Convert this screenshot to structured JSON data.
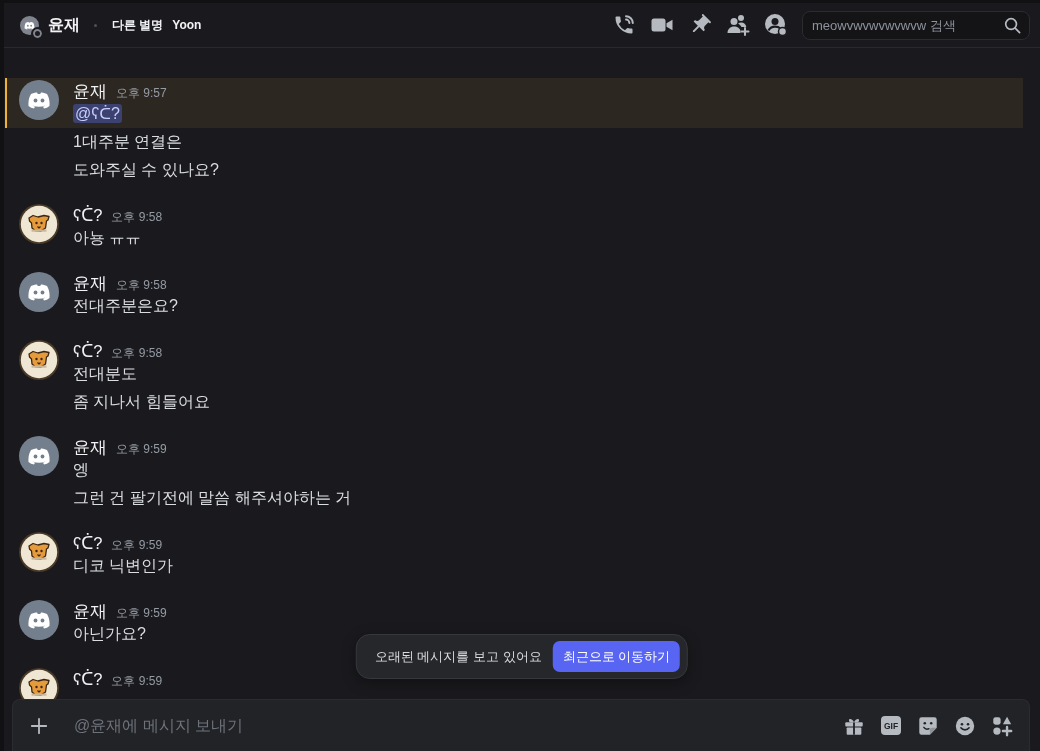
{
  "header": {
    "title": "윤재",
    "online": false,
    "alias_label": "다른 별명",
    "alias": "Yoon",
    "search": {
      "placeholder": "meowvwvwvwvwvw 검색"
    }
  },
  "messages": [
    {
      "author": "윤재",
      "avatar": {
        "kind": "default"
      },
      "time": "오후 9:57",
      "lines": [
        {
          "text": "@ʕᑖ?",
          "kind": "mention",
          "highlighted": true
        },
        {
          "text": "1대주분 연결은",
          "kind": "text",
          "highlighted": false
        },
        {
          "text": "도와주실 수 있나요?",
          "kind": "text",
          "highlighted": false
        }
      ]
    },
    {
      "author": "ʕᑖ?",
      "avatar": {
        "kind": "picture"
      },
      "time": "오후 9:58",
      "lines": [
        {
          "text": "아뇽 ㅠㅠ",
          "kind": "text",
          "highlighted": false
        }
      ]
    },
    {
      "author": "윤재",
      "avatar": {
        "kind": "default"
      },
      "time": "오후 9:58",
      "lines": [
        {
          "text": "전대주분은요?",
          "kind": "text",
          "highlighted": false
        }
      ]
    },
    {
      "author": "ʕᑖ?",
      "avatar": {
        "kind": "picture"
      },
      "time": "오후 9:58",
      "lines": [
        {
          "text": "전대분도",
          "kind": "text",
          "highlighted": false
        },
        {
          "text": "좀 지나서 힘들어요",
          "kind": "text",
          "highlighted": false
        }
      ]
    },
    {
      "author": "윤재",
      "avatar": {
        "kind": "default"
      },
      "time": "오후 9:59",
      "lines": [
        {
          "text": "엥",
          "kind": "text",
          "highlighted": false
        },
        {
          "text": "그런 건 팔기전에 말씀 해주셔야하는 거",
          "kind": "text",
          "highlighted": false
        }
      ]
    },
    {
      "author": "ʕᑖ?",
      "avatar": {
        "kind": "picture"
      },
      "time": "오후 9:59",
      "lines": [
        {
          "text": "디코 닉변인가",
          "kind": "text",
          "highlighted": false
        }
      ]
    },
    {
      "author": "윤재",
      "avatar": {
        "kind": "default"
      },
      "time": "오후 9:59",
      "lines": [
        {
          "text": "아닌가요?",
          "kind": "text",
          "highlighted": false
        }
      ]
    },
    {
      "author": "ʕᑖ?",
      "avatar": {
        "kind": "picture"
      },
      "time": "오후 9:59"
    }
  ],
  "toast": {
    "text": "오래된 메시지를 보고 있어요",
    "button": "최근으로 이동하기"
  },
  "composer": {
    "placeholder": "@윤재에 메시지 보내기",
    "gif_label": "GIF"
  }
}
